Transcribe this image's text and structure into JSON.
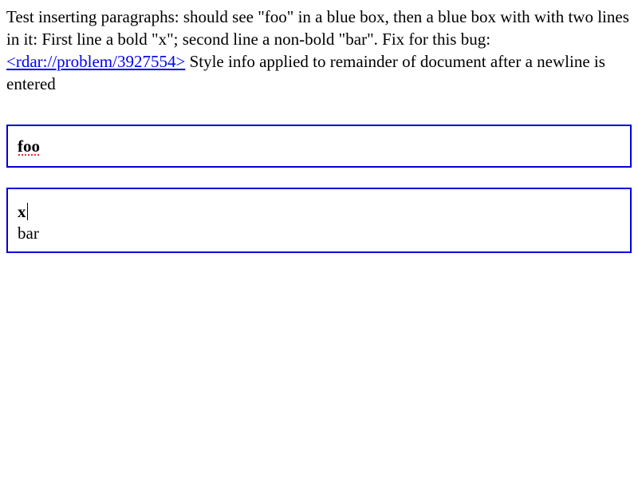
{
  "intro": {
    "text_before_link": "Test inserting paragraphs: should see \"foo\" in a blue box, then a blue box with with two lines in it: First line a bold \"x\"; second line a non-bold \"bar\". Fix for this bug: ",
    "link_text": "<rdar://problem/3927554>",
    "text_after_link": " Style info applied to remainder of document after a newline is entered"
  },
  "box1": {
    "text": "foo"
  },
  "box2": {
    "line1": "x",
    "line2": "bar"
  },
  "colors": {
    "box_border": "#0000d8",
    "link": "#0000ee",
    "spellcheck_underline": "#e02020"
  }
}
